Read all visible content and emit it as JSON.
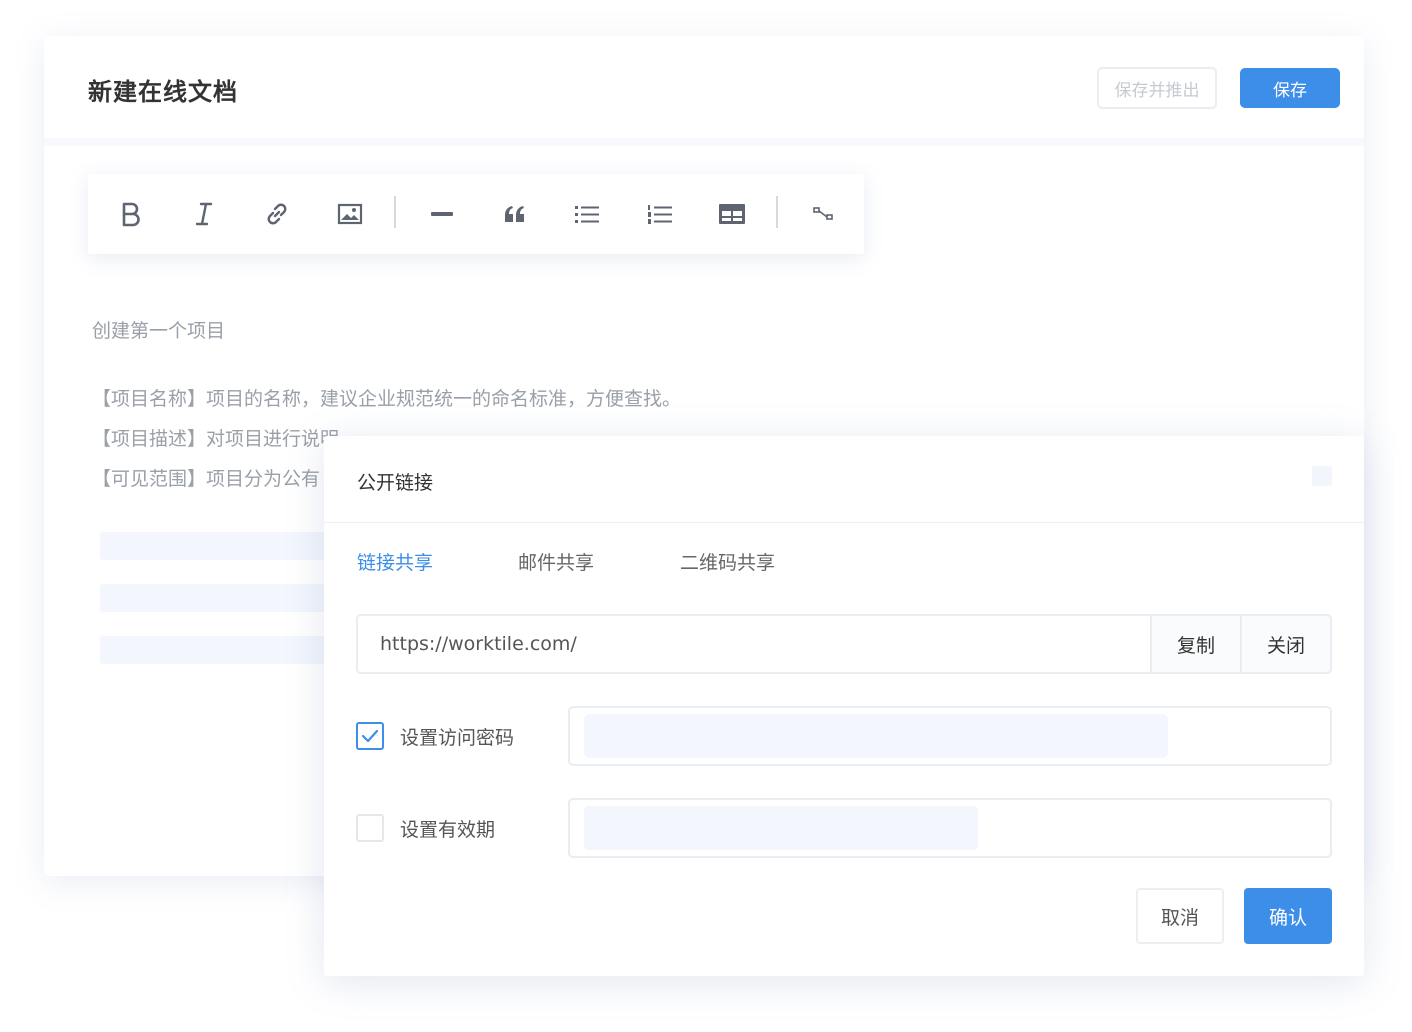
{
  "document": {
    "title": "新建在线文档",
    "save_and_exit_label": "保存并推出",
    "save_label": "保存",
    "toolbar": {
      "icons": [
        "bold-icon",
        "italic-icon",
        "link-icon",
        "image-icon",
        "horizontal-rule-icon",
        "quote-icon",
        "bullet-list-icon",
        "ordered-list-icon",
        "table-icon",
        "code-block-icon"
      ]
    },
    "content": {
      "heading": "创建第一个项目",
      "lines": [
        "【项目名称】项目的名称，建议企业规范统一的命名标准，方便查找。",
        "【项目描述】对项目进行说明。",
        "【可见范围】项目分为公有"
      ]
    }
  },
  "share_dialog": {
    "title": "公开链接",
    "tabs": [
      {
        "label": "链接共享",
        "active": true
      },
      {
        "label": "邮件共享",
        "active": false
      },
      {
        "label": "二维码共享",
        "active": false
      }
    ],
    "link_value": "https://worktile.com/",
    "copy_label": "复制",
    "close_label": "关闭",
    "password_option": {
      "label": "设置访问密码",
      "checked": true
    },
    "expiry_option": {
      "label": "设置有效期",
      "checked": false
    },
    "cancel_label": "取消",
    "confirm_label": "确认"
  },
  "colors": {
    "accent": "#3d8ee8",
    "placeholder_fill": "#f3f6fd",
    "muted_text": "#9aa0a8"
  }
}
